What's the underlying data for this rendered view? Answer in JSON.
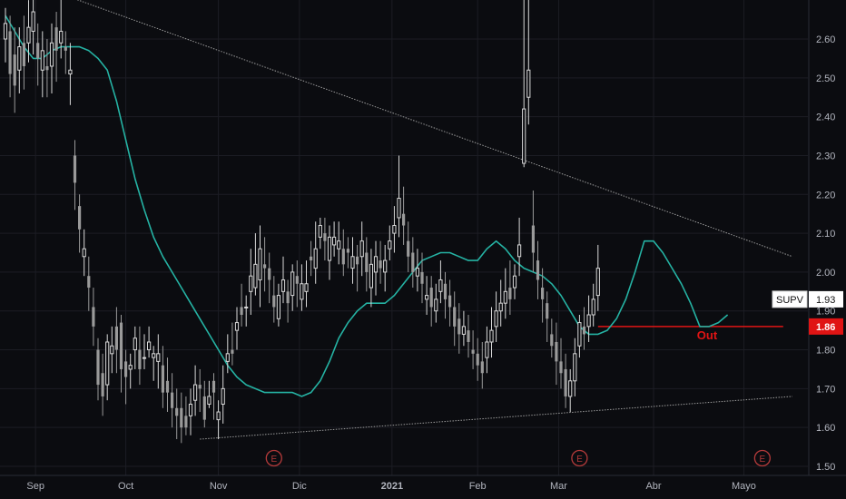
{
  "chart_data": {
    "type": "candlestick",
    "symbol": "SUPV",
    "ylim": [
      1.49,
      2.71
    ],
    "y_ticks": [
      "1.50",
      "1.60",
      "1.70",
      "1.80",
      "1.90",
      "2.00",
      "2.10",
      "2.20",
      "2.30",
      "2.40",
      "2.50",
      "2.60"
    ],
    "x_labels": [
      "Sep",
      "Oct",
      "Nov",
      "Dic",
      "2021",
      "Feb",
      "Mar",
      "Abr",
      "Mayo"
    ],
    "last_price_label": "1.93",
    "line_label": "1.86",
    "annotation": "Out",
    "earnings_marker": "E",
    "moving_average": [
      [
        0,
        2.66
      ],
      [
        2,
        2.62
      ],
      [
        4,
        2.58
      ],
      [
        6,
        2.55
      ],
      [
        8,
        2.55
      ],
      [
        10,
        2.57
      ],
      [
        12,
        2.58
      ],
      [
        14,
        2.58
      ],
      [
        16,
        2.58
      ],
      [
        18,
        2.57
      ],
      [
        20,
        2.55
      ],
      [
        22,
        2.52
      ],
      [
        24,
        2.44
      ],
      [
        26,
        2.34
      ],
      [
        28,
        2.24
      ],
      [
        30,
        2.16
      ],
      [
        32,
        2.09
      ],
      [
        34,
        2.04
      ],
      [
        36,
        2.0
      ],
      [
        38,
        1.96
      ],
      [
        40,
        1.92
      ],
      [
        42,
        1.88
      ],
      [
        44,
        1.84
      ],
      [
        46,
        1.8
      ],
      [
        48,
        1.76
      ],
      [
        50,
        1.73
      ],
      [
        52,
        1.71
      ],
      [
        54,
        1.7
      ],
      [
        56,
        1.69
      ],
      [
        58,
        1.69
      ],
      [
        60,
        1.69
      ],
      [
        62,
        1.69
      ],
      [
        64,
        1.68
      ],
      [
        66,
        1.69
      ],
      [
        68,
        1.72
      ],
      [
        70,
        1.77
      ],
      [
        72,
        1.83
      ],
      [
        74,
        1.87
      ],
      [
        76,
        1.9
      ],
      [
        78,
        1.92
      ],
      [
        80,
        1.92
      ],
      [
        82,
        1.92
      ],
      [
        84,
        1.94
      ],
      [
        86,
        1.97
      ],
      [
        88,
        2.0
      ],
      [
        90,
        2.03
      ],
      [
        92,
        2.04
      ],
      [
        94,
        2.05
      ],
      [
        96,
        2.05
      ],
      [
        98,
        2.04
      ],
      [
        100,
        2.03
      ],
      [
        102,
        2.03
      ],
      [
        104,
        2.06
      ],
      [
        106,
        2.08
      ],
      [
        108,
        2.06
      ],
      [
        110,
        2.03
      ],
      [
        112,
        2.01
      ],
      [
        114,
        2.0
      ],
      [
        116,
        1.99
      ],
      [
        118,
        1.97
      ],
      [
        120,
        1.94
      ],
      [
        122,
        1.9
      ],
      [
        124,
        1.86
      ],
      [
        126,
        1.84
      ],
      [
        128,
        1.84
      ],
      [
        130,
        1.85
      ],
      [
        132,
        1.88
      ],
      [
        134,
        1.93
      ],
      [
        136,
        2.0
      ],
      [
        138,
        2.08
      ],
      [
        140,
        2.08
      ],
      [
        142,
        2.05
      ],
      [
        144,
        2.01
      ],
      [
        146,
        1.97
      ],
      [
        148,
        1.92
      ],
      [
        150,
        1.86
      ],
      [
        152,
        1.86
      ],
      [
        154,
        1.87
      ],
      [
        156,
        1.89
      ]
    ],
    "candles": [
      [
        0,
        2.6,
        2.64,
        2.68,
        2.54
      ],
      [
        1,
        2.62,
        2.51,
        2.66,
        2.45
      ],
      [
        2,
        2.56,
        2.48,
        2.63,
        2.41
      ],
      [
        3,
        2.52,
        2.58,
        2.63,
        2.46
      ],
      [
        4,
        2.59,
        2.53,
        2.66,
        2.47
      ],
      [
        5,
        2.59,
        2.63,
        2.7,
        2.54
      ],
      [
        6,
        2.62,
        2.67,
        2.71,
        2.56
      ],
      [
        7,
        2.59,
        2.55,
        2.64,
        2.48
      ],
      [
        8,
        2.52,
        2.57,
        2.62,
        2.45
      ],
      [
        9,
        2.53,
        2.52,
        2.6,
        2.45
      ],
      [
        10,
        2.53,
        2.59,
        2.64,
        2.46
      ],
      [
        11,
        2.63,
        2.57,
        2.67,
        2.49
      ],
      [
        12,
        2.59,
        2.62,
        2.71,
        2.55
      ],
      [
        13,
        2.58,
        2.57,
        2.62,
        2.51
      ],
      [
        14,
        2.51,
        2.52,
        2.59,
        2.43
      ],
      [
        15,
        2.3,
        2.23,
        2.34,
        2.16
      ],
      [
        16,
        2.17,
        2.11,
        2.2,
        2.05
      ],
      [
        17,
        2.04,
        2.06,
        2.11,
        1.99
      ],
      [
        18,
        1.99,
        1.96,
        2.04,
        1.9
      ],
      [
        19,
        1.91,
        1.86,
        1.96,
        1.81
      ],
      [
        20,
        1.8,
        1.71,
        1.83,
        1.67
      ],
      [
        21,
        1.74,
        1.68,
        1.79,
        1.63
      ],
      [
        22,
        1.71,
        1.82,
        1.84,
        1.67
      ],
      [
        23,
        1.79,
        1.81,
        1.86,
        1.74
      ],
      [
        24,
        1.86,
        1.8,
        1.91,
        1.74
      ],
      [
        25,
        1.87,
        1.75,
        1.89,
        1.69
      ],
      [
        26,
        1.77,
        1.73,
        1.8,
        1.66
      ],
      [
        27,
        1.75,
        1.76,
        1.79,
        1.7
      ],
      [
        28,
        1.8,
        1.83,
        1.86,
        1.75
      ],
      [
        29,
        1.8,
        1.75,
        1.86,
        1.71
      ],
      [
        30,
        1.78,
        1.78,
        1.84,
        1.75
      ],
      [
        31,
        1.8,
        1.82,
        1.86,
        1.78
      ],
      [
        32,
        1.78,
        1.79,
        1.81,
        1.72
      ],
      [
        33,
        1.77,
        1.79,
        1.84,
        1.7
      ],
      [
        34,
        1.76,
        1.69,
        1.81,
        1.65
      ],
      [
        35,
        1.72,
        1.69,
        1.78,
        1.64
      ],
      [
        36,
        1.69,
        1.65,
        1.74,
        1.6
      ],
      [
        37,
        1.65,
        1.63,
        1.7,
        1.57
      ],
      [
        38,
        1.65,
        1.6,
        1.69,
        1.56
      ],
      [
        39,
        1.63,
        1.6,
        1.68,
        1.58
      ],
      [
        40,
        1.63,
        1.66,
        1.7,
        1.58
      ],
      [
        41,
        1.67,
        1.71,
        1.76,
        1.63
      ],
      [
        42,
        1.71,
        1.7,
        1.75,
        1.64
      ],
      [
        43,
        1.68,
        1.62,
        1.72,
        1.6
      ],
      [
        44,
        1.66,
        1.68,
        1.72,
        1.65
      ],
      [
        45,
        1.72,
        1.69,
        1.74,
        1.62
      ],
      [
        46,
        1.62,
        1.64,
        1.67,
        1.57
      ],
      [
        47,
        1.66,
        1.7,
        1.76,
        1.61
      ],
      [
        48,
        1.77,
        1.79,
        1.84,
        1.74
      ],
      [
        49,
        1.8,
        1.79,
        1.87,
        1.76
      ],
      [
        50,
        1.85,
        1.87,
        1.91,
        1.8
      ],
      [
        51,
        1.91,
        1.89,
        1.97,
        1.86
      ],
      [
        52,
        1.91,
        1.91,
        1.94,
        1.86
      ],
      [
        53,
        1.95,
        1.99,
        2.06,
        1.89
      ],
      [
        54,
        1.96,
        2.02,
        2.1,
        1.94
      ],
      [
        55,
        1.98,
        2.06,
        2.12,
        1.91
      ],
      [
        56,
        2.02,
        2.01,
        2.09,
        1.95
      ],
      [
        57,
        2.01,
        1.98,
        2.05,
        1.92
      ],
      [
        58,
        1.94,
        1.91,
        1.99,
        1.87
      ],
      [
        59,
        1.88,
        1.94,
        1.97,
        1.86
      ],
      [
        60,
        1.95,
        1.98,
        2.04,
        1.92
      ],
      [
        61,
        1.95,
        1.92,
        1.98,
        1.87
      ],
      [
        62,
        1.94,
        2.0,
        2.02,
        1.9
      ],
      [
        63,
        1.99,
        1.97,
        2.03,
        1.91
      ],
      [
        64,
        1.93,
        1.97,
        2.02,
        1.9
      ],
      [
        65,
        1.95,
        1.97,
        2.03,
        1.91
      ],
      [
        66,
        2.04,
        2.03,
        2.08,
        1.99
      ],
      [
        67,
        2.01,
        2.06,
        2.13,
        1.97
      ],
      [
        68,
        2.09,
        2.12,
        2.14,
        2.06
      ],
      [
        69,
        2.1,
        2.08,
        2.14,
        2.03
      ],
      [
        70,
        2.03,
        2.09,
        2.12,
        1.98
      ],
      [
        71,
        2.07,
        2.09,
        2.13,
        2.04
      ],
      [
        72,
        2.06,
        2.08,
        2.13,
        2.02
      ],
      [
        73,
        2.06,
        2.02,
        2.11,
        1.99
      ],
      [
        74,
        2.06,
        2.05,
        2.09,
        2.01
      ],
      [
        75,
        2.01,
        2.04,
        2.09,
        1.97
      ],
      [
        76,
        2.04,
        2.02,
        2.07,
        1.95
      ],
      [
        77,
        2.04,
        2.08,
        2.13,
        1.99
      ],
      [
        78,
        2.05,
        2.0,
        2.09,
        1.95
      ],
      [
        79,
        1.96,
        2.02,
        2.06,
        1.91
      ],
      [
        80,
        2.0,
        2.04,
        2.08,
        1.94
      ],
      [
        81,
        2.03,
        2.01,
        2.08,
        1.97
      ],
      [
        82,
        2.0,
        2.03,
        2.07,
        1.95
      ],
      [
        83,
        2.06,
        2.08,
        2.12,
        2.03
      ],
      [
        84,
        2.1,
        2.12,
        2.17,
        2.05
      ],
      [
        85,
        2.14,
        2.19,
        2.3,
        2.09
      ],
      [
        86,
        2.15,
        2.12,
        2.22,
        2.07
      ],
      [
        87,
        2.08,
        2.04,
        2.13,
        2.0
      ],
      [
        88,
        2.05,
        2.0,
        2.09,
        1.96
      ],
      [
        89,
        1.99,
        2.01,
        2.06,
        1.95
      ],
      [
        90,
        2.0,
        1.97,
        2.05,
        1.92
      ],
      [
        91,
        1.93,
        1.94,
        1.99,
        1.89
      ],
      [
        92,
        1.96,
        1.91,
        1.99,
        1.86
      ],
      [
        93,
        1.9,
        1.93,
        1.97,
        1.87
      ],
      [
        94,
        1.95,
        1.98,
        2.03,
        1.92
      ],
      [
        95,
        1.97,
        1.93,
        2.0,
        1.88
      ],
      [
        96,
        1.94,
        1.91,
        1.98,
        1.86
      ],
      [
        97,
        1.91,
        1.86,
        1.95,
        1.81
      ],
      [
        98,
        1.88,
        1.84,
        1.92,
        1.79
      ],
      [
        99,
        1.84,
        1.86,
        1.9,
        1.81
      ],
      [
        100,
        1.85,
        1.82,
        1.89,
        1.78
      ],
      [
        101,
        1.8,
        1.79,
        1.85,
        1.75
      ],
      [
        102,
        1.79,
        1.76,
        1.83,
        1.72
      ],
      [
        103,
        1.77,
        1.74,
        1.82,
        1.7
      ],
      [
        104,
        1.78,
        1.82,
        1.86,
        1.74
      ],
      [
        105,
        1.82,
        1.85,
        1.91,
        1.78
      ],
      [
        106,
        1.86,
        1.9,
        1.95,
        1.82
      ],
      [
        107,
        1.9,
        1.92,
        1.98,
        1.86
      ],
      [
        108,
        1.92,
        1.95,
        2.01,
        1.88
      ],
      [
        109,
        1.96,
        1.93,
        2.03,
        1.89
      ],
      [
        110,
        1.96,
        1.99,
        2.02,
        1.93
      ],
      [
        111,
        2.04,
        2.07,
        2.14,
        1.99
      ],
      [
        112,
        2.28,
        2.42,
        2.71,
        2.27
      ],
      [
        113,
        2.45,
        2.52,
        2.71,
        2.38
      ],
      [
        114,
        2.12,
        2.05,
        2.21,
        2.0
      ],
      [
        115,
        2.03,
        1.98,
        2.08,
        1.93
      ],
      [
        116,
        1.96,
        1.93,
        2.01,
        1.87
      ],
      [
        117,
        1.92,
        1.88,
        1.95,
        1.82
      ],
      [
        118,
        1.84,
        1.81,
        1.88,
        1.78
      ],
      [
        119,
        1.82,
        1.77,
        1.87,
        1.71
      ],
      [
        120,
        1.77,
        1.74,
        1.83,
        1.7
      ],
      [
        121,
        1.75,
        1.68,
        1.79,
        1.65
      ],
      [
        122,
        1.68,
        1.72,
        1.75,
        1.64
      ],
      [
        123,
        1.72,
        1.79,
        1.83,
        1.68
      ],
      [
        124,
        1.81,
        1.87,
        1.89,
        1.78
      ],
      [
        125,
        1.86,
        1.84,
        1.91,
        1.8
      ],
      [
        126,
        1.86,
        1.89,
        1.94,
        1.82
      ],
      [
        127,
        1.89,
        1.93,
        1.97,
        1.86
      ],
      [
        128,
        1.94,
        2.01,
        2.07,
        1.9
      ]
    ],
    "lines": {
      "resistance": [
        [
          -52,
          2.99
        ],
        [
          170,
          2.04
        ]
      ],
      "support": [
        [
          42,
          1.57
        ],
        [
          170,
          1.68
        ]
      ],
      "out_level": [
        [
          128,
          1.86
        ],
        [
          168,
          1.86
        ]
      ]
    },
    "colors": {
      "background": "#0b0c10",
      "grid": "#1c1d24",
      "candle_up": "#d9d9d9",
      "candle_down": "#9a9a9a",
      "moving_average": "#25b2a3",
      "out_line": "#e01414",
      "out_label": "#e01414",
      "earnings": "#b33a3a",
      "trendline": "#9a9a9a"
    }
  }
}
